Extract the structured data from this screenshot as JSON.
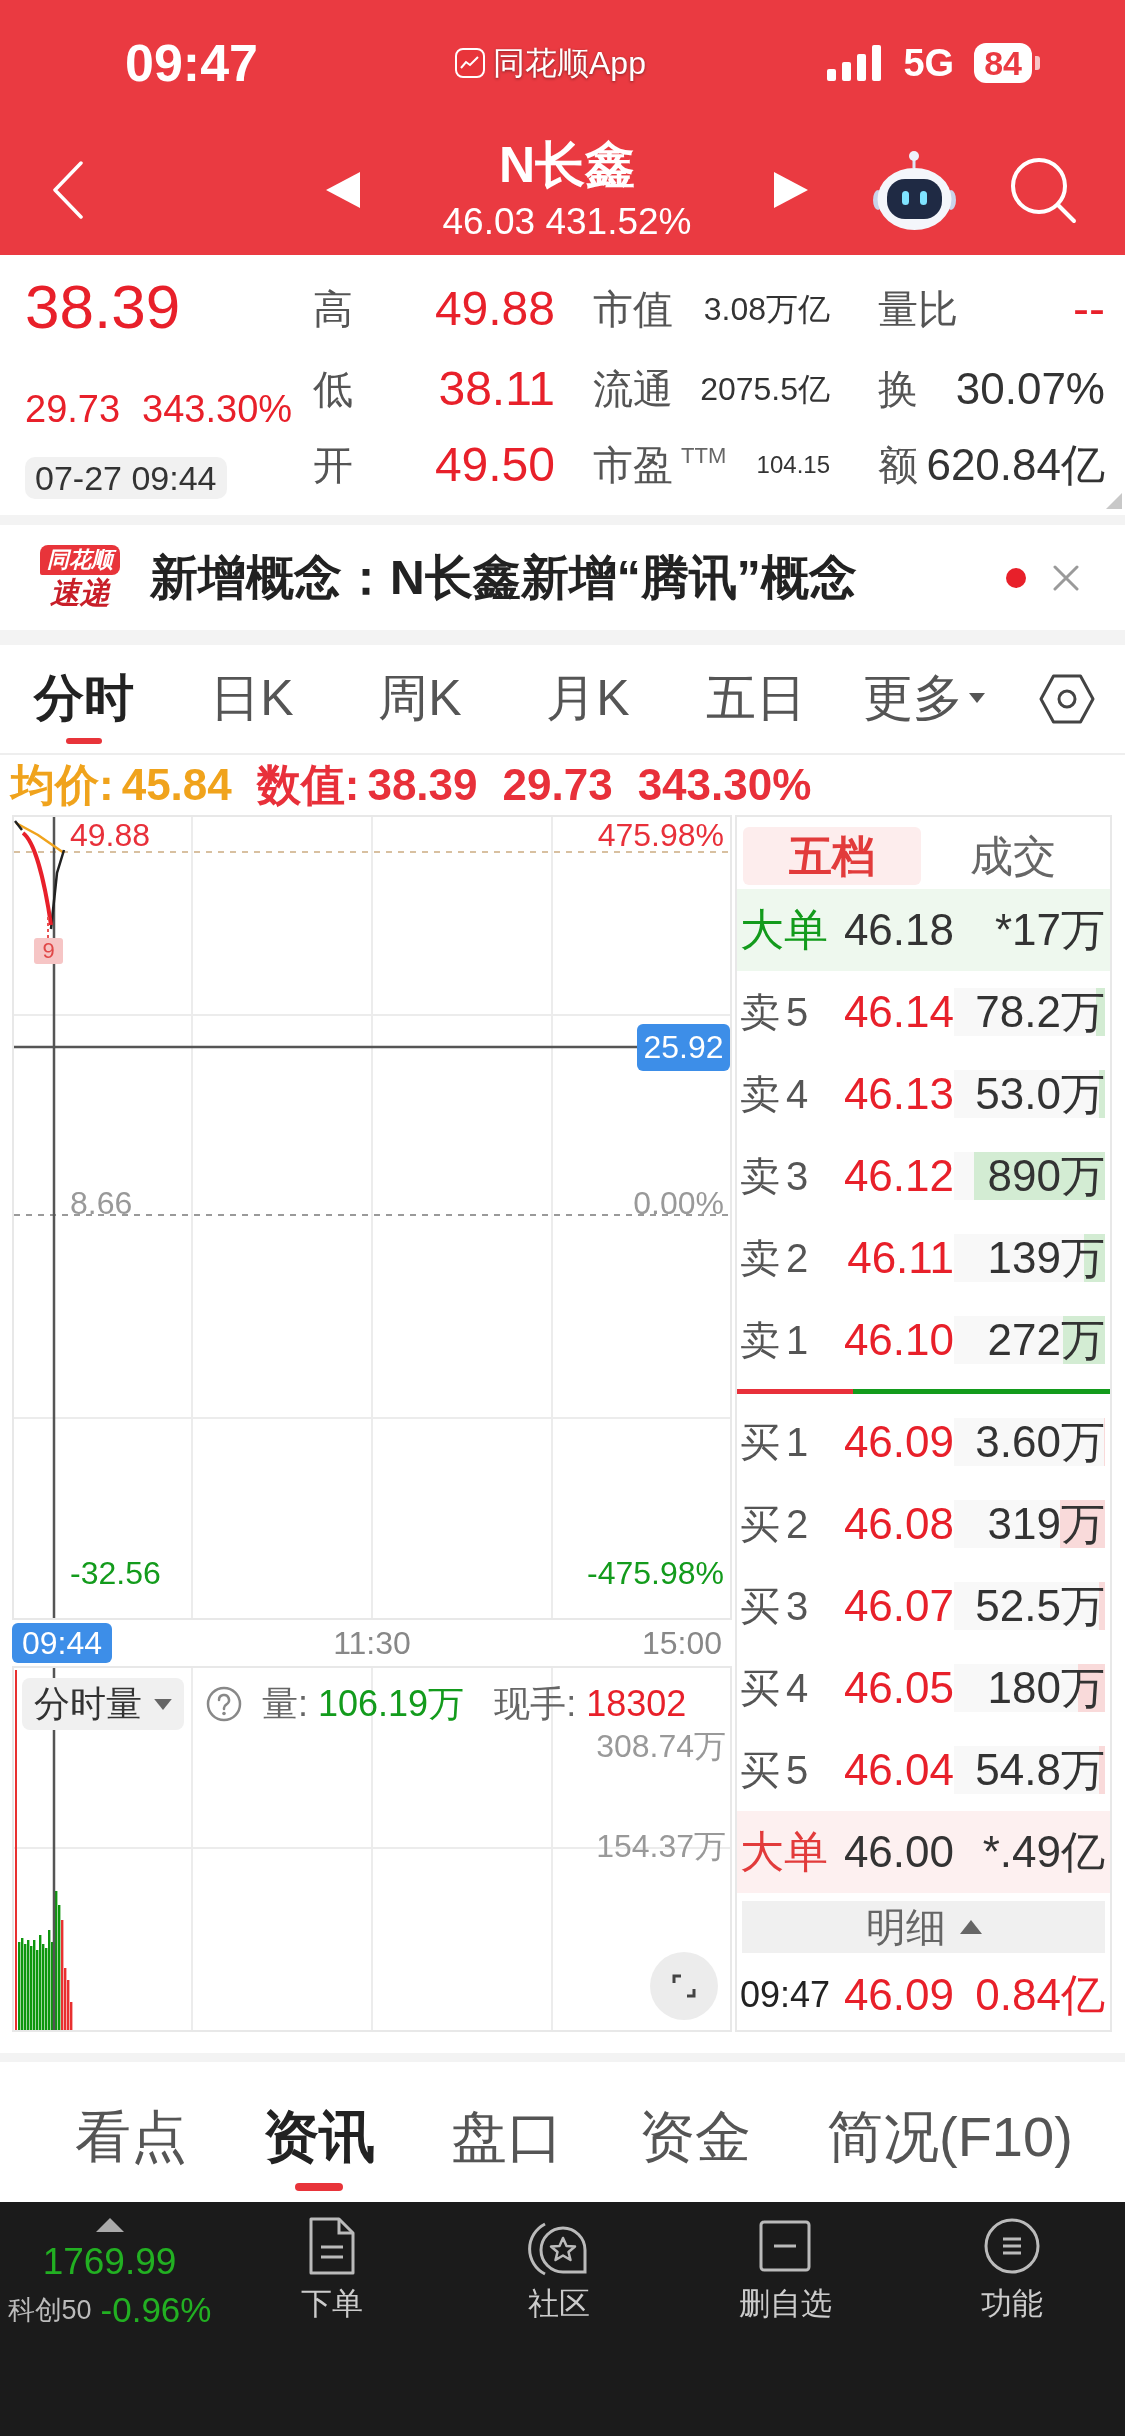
{
  "status_bar": {
    "time": "09:47",
    "app_label": "同花顺App",
    "network": "5G",
    "battery": "84"
  },
  "header": {
    "title": "N长鑫",
    "subtitle": "46.03 431.52%"
  },
  "quote": {
    "price": "38.39",
    "change": "29.73",
    "change_percent": "343.30%",
    "timestamp": "07-27 09:44",
    "stats": [
      [
        {
          "label": "高",
          "value": "49.88",
          "kind": "price"
        },
        {
          "label": "市值",
          "value": "3.08万亿",
          "kind": "small"
        },
        {
          "label": "量比",
          "value": "--",
          "kind": "price"
        }
      ],
      [
        {
          "label": "低",
          "value": "38.11",
          "kind": "price"
        },
        {
          "label": "流通",
          "value": "2075.5亿",
          "kind": "small"
        },
        {
          "label": "换",
          "value": "30.07%",
          "kind": "figure"
        }
      ],
      [
        {
          "label": "开",
          "value": "49.50",
          "kind": "price"
        },
        {
          "label": "市盈$^{TTM}$",
          "value": "104.15",
          "kind": "compact"
        },
        {
          "label": "额",
          "value": "620.84亿",
          "kind": "figure"
        }
      ]
    ]
  },
  "news": {
    "badge": "同花顺",
    "badge_caption": "速递",
    "text": "新增概念：N长鑫新增“腾讯”概念",
    "unread": true
  },
  "period_tabs": [
    {
      "label": "分时",
      "selected": true,
      "kind": "tab"
    },
    {
      "label": "日K",
      "selected": false,
      "kind": "tab"
    },
    {
      "label": "周K",
      "selected": false,
      "kind": "tab"
    },
    {
      "label": "月K",
      "selected": false,
      "kind": "tab"
    },
    {
      "label": "五日",
      "selected": false,
      "kind": "tab"
    },
    {
      "label": "更多",
      "selected": false,
      "kind": "menu"
    }
  ],
  "chart": {
    "average": {
      "label": "均价:",
      "value": "45.84"
    },
    "readout": {
      "label": "数值:",
      "values": [
        "38.39",
        "29.73",
        "343.30%"
      ]
    },
    "price_labels": [
      "49.88",
      "8.66",
      "-32.56"
    ],
    "percent_labels": [
      "475.98%",
      "0.00%",
      "-475.98%"
    ],
    "crosshair_value": "25.92",
    "marker_label": "9",
    "time_labels": [
      {
        "label": "09:44",
        "highlighted": true
      },
      {
        "label": "11:30",
        "highlighted": false
      },
      {
        "label": "15:00",
        "highlighted": false
      }
    ]
  },
  "volume_chart": {
    "indicator": "分时量",
    "volume_label": "量:",
    "volume_value": "106.19万",
    "hand_label": "现手:",
    "hand_value": "18302",
    "axis_labels": [
      "308.74万",
      "154.37万"
    ]
  },
  "order_book": {
    "tabs": [
      {
        "label": "五档",
        "selected": true
      },
      {
        "label": "成交",
        "selected": false
      }
    ],
    "big_order_top": {
      "label": "大单",
      "price": "46.18",
      "volume": "*17万",
      "kind": "sell"
    },
    "asks": [
      {
        "label": "卖5",
        "price": "46.14",
        "volume": "78.2万",
        "level": 0.06
      },
      {
        "label": "卖4",
        "price": "46.13",
        "volume": "53.0万",
        "level": 0.04
      },
      {
        "label": "卖3",
        "price": "46.12",
        "volume": "890万",
        "level": 0.87
      },
      {
        "label": "卖2",
        "price": "46.11",
        "volume": "139万",
        "level": 0.14
      },
      {
        "label": "卖1",
        "price": "46.10",
        "volume": "272万",
        "level": 0.28
      }
    ],
    "balance": {
      "level": 0.31
    },
    "bids": [
      {
        "label": "买1",
        "price": "46.09",
        "volume": "3.60万",
        "level": 0.01
      },
      {
        "label": "买2",
        "price": "46.08",
        "volume": "319万",
        "level": 0.3
      },
      {
        "label": "买3",
        "price": "46.07",
        "volume": "52.5万",
        "level": 0.04
      },
      {
        "label": "买4",
        "price": "46.05",
        "volume": "180万",
        "level": 0.18
      },
      {
        "label": "买5",
        "price": "46.04",
        "volume": "54.8万",
        "level": 0.04
      }
    ],
    "big_order_bottom": {
      "label": "大单",
      "price": "46.00",
      "volume": "*.49亿",
      "kind": "buy"
    },
    "detail_button": "明细",
    "last_trade": {
      "time": "09:47",
      "price": "46.09",
      "amount": "0.84亿"
    }
  },
  "section_tabs": [
    {
      "label": "看点",
      "selected": false
    },
    {
      "label": "资讯",
      "selected": true
    },
    {
      "label": "盘口",
      "selected": false
    },
    {
      "label": "资金",
      "selected": false
    },
    {
      "label": "简况(F10)",
      "selected": false
    }
  ],
  "bottom_bar": {
    "index": {
      "value": "1769.99",
      "name": "科创50",
      "change": "-0.96%"
    },
    "items": [
      {
        "label": "下单"
      },
      {
        "label": "社区"
      },
      {
        "label": "删自选"
      },
      {
        "label": "功能"
      }
    ]
  }
}
